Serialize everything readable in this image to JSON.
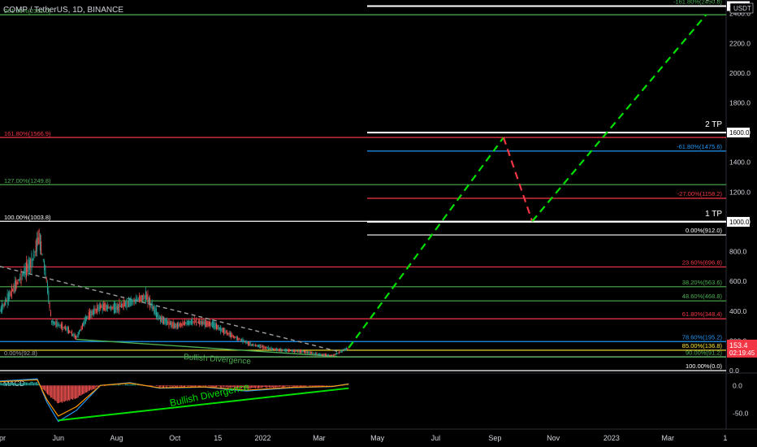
{
  "header": {
    "title": "COMP / TetherUS, 1D, BINANCE",
    "currency": "USDT"
  },
  "price_axis": {
    "ticks": [
      "2400.0",
      "2200.0",
      "2000.0",
      "1800.0",
      "1600.0",
      "1400.0",
      "1200.0",
      "1000.0",
      "800.0",
      "600.0",
      "400.0",
      "200.0",
      "0.0"
    ],
    "last_price": "153.4",
    "countdown": "02:19:45",
    "last_price_color": "#f23645"
  },
  "macd_axis": {
    "label": "MACD",
    "ticks": [
      "0.0",
      "-50.0"
    ]
  },
  "time_axis": {
    "labels": [
      "Apr",
      "Jun",
      "Aug",
      "Oct",
      "15",
      "2022",
      "Mar",
      "May",
      "Jul",
      "Sep",
      "Nov",
      "2023",
      "Mar",
      "1"
    ]
  },
  "targets": [
    "3 TP",
    "2 TP",
    "1 TP"
  ],
  "target_prices": [
    "2450.0",
    "1600.0",
    "1000.0"
  ],
  "annotations": {
    "divergence_price": "Bullish Divergence",
    "divergence_macd": "Bullish Divergence"
  },
  "fib_levels_right": [
    {
      "label": "-161.80%(2450.8)",
      "price": 2450.8,
      "color": "#4caf50"
    },
    {
      "label": "-61.80%(1475.6)",
      "price": 1475.6,
      "color": "#2196f3"
    },
    {
      "label": "-27.00%(1158.2)",
      "price": 1158.2,
      "color": "#f23645"
    },
    {
      "label": "0.00%(912.0)",
      "price": 912.0,
      "color": "#ffffff"
    },
    {
      "label": "23.60%(696.8)",
      "price": 696.8,
      "color": "#f23645"
    },
    {
      "label": "38.20%(563.6)",
      "price": 563.6,
      "color": "#4caf50"
    },
    {
      "label": "48.60%(468.8)",
      "price": 468.8,
      "color": "#4caf50"
    },
    {
      "label": "61.80%(348.4)",
      "price": 348.4,
      "color": "#f23645"
    },
    {
      "label": "78.60%(195.2)",
      "price": 195.2,
      "color": "#2196f3"
    },
    {
      "label": "85.00%(136.8)",
      "price": 136.8,
      "color": "#ffeb3b"
    },
    {
      "label": "90.00%(91.2)",
      "price": 91.2,
      "color": "#4caf50"
    },
    {
      "label": "100.00%(0.0)",
      "price": 0.0,
      "color": "#ffffff"
    }
  ],
  "fib_levels_left": [
    {
      "label": "261.80%(2392.0)",
      "price": 2392.0,
      "color": "#4caf50"
    },
    {
      "label": "161.80%(1566.9)",
      "price": 1566.9,
      "color": "#f23645"
    },
    {
      "label": "127.00%(1249.8)",
      "price": 1249.8,
      "color": "#4caf50"
    },
    {
      "label": "100.00%(1003.8)",
      "price": 1003.8,
      "color": "#ffffff"
    },
    {
      "label": "0.00%(92.8)",
      "price": 92.8,
      "color": "#9e9e9e"
    }
  ],
  "chart_data": {
    "type": "candlestick",
    "symbol": "COMP / TetherUS",
    "interval": "1D",
    "exchange": "BINANCE",
    "ylim": [
      0,
      2480
    ],
    "x_start": "2021-04-01",
    "x_end": "2023-05-01",
    "price_path": [
      {
        "date": "2021-04-01",
        "value": 400
      },
      {
        "date": "2021-04-20",
        "value": 600
      },
      {
        "date": "2021-05-05",
        "value": 740
      },
      {
        "date": "2021-05-12",
        "value": 900
      },
      {
        "date": "2021-05-19",
        "value": 650
      },
      {
        "date": "2021-05-25",
        "value": 330
      },
      {
        "date": "2021-06-10",
        "value": 280
      },
      {
        "date": "2021-06-20",
        "value": 220
      },
      {
        "date": "2021-07-01",
        "value": 360
      },
      {
        "date": "2021-07-15",
        "value": 430
      },
      {
        "date": "2021-08-01",
        "value": 420
      },
      {
        "date": "2021-08-15",
        "value": 460
      },
      {
        "date": "2021-09-01",
        "value": 500
      },
      {
        "date": "2021-09-15",
        "value": 350
      },
      {
        "date": "2021-10-01",
        "value": 300
      },
      {
        "date": "2021-10-20",
        "value": 330
      },
      {
        "date": "2021-11-10",
        "value": 310
      },
      {
        "date": "2021-12-01",
        "value": 230
      },
      {
        "date": "2021-12-20",
        "value": 175
      },
      {
        "date": "2022-01-15",
        "value": 140
      },
      {
        "date": "2022-02-10",
        "value": 130
      },
      {
        "date": "2022-03-01",
        "value": 110
      },
      {
        "date": "2022-03-15",
        "value": 100
      },
      {
        "date": "2022-04-01",
        "value": 153.4
      }
    ],
    "projection": [
      {
        "date": "2022-04-01",
        "value": 153.4
      },
      {
        "date": "2022-09-10",
        "value": 1566.9
      },
      {
        "date": "2022-10-10",
        "value": 1003.8
      },
      {
        "date": "2023-04-10",
        "value": 2392
      }
    ],
    "projection_colors": [
      "#00e000",
      "#f23645",
      "#00e000"
    ],
    "trendlines": [
      {
        "name": "resistance",
        "from": {
          "date": "2021-04-01",
          "value": 700
        },
        "to": {
          "date": "2022-03-20",
          "value": 130
        },
        "color": "#9e9e9e",
        "style": "dashed"
      },
      {
        "name": "support",
        "from": {
          "date": "2021-06-20",
          "value": 210
        },
        "to": {
          "date": "2022-03-20",
          "value": 95
        },
        "color": "#4caf50",
        "style": "solid"
      }
    ],
    "macd": {
      "ylim": [
        -70,
        18
      ],
      "path": [
        {
          "date": "2021-04-01",
          "value": 8
        },
        {
          "date": "2021-05-10",
          "value": 12
        },
        {
          "date": "2021-05-20",
          "value": -30
        },
        {
          "date": "2021-06-01",
          "value": -65
        },
        {
          "date": "2021-06-20",
          "value": -45
        },
        {
          "date": "2021-07-15",
          "value": 0
        },
        {
          "date": "2021-08-15",
          "value": 5
        },
        {
          "date": "2021-09-15",
          "value": -5
        },
        {
          "date": "2021-11-01",
          "value": -3
        },
        {
          "date": "2021-12-15",
          "value": -10
        },
        {
          "date": "2022-02-01",
          "value": -4
        },
        {
          "date": "2022-03-15",
          "value": -2
        },
        {
          "date": "2022-04-01",
          "value": 3
        }
      ],
      "divergence_line": {
        "from": {
          "date": "2021-06-01",
          "value": -63
        },
        "to": {
          "date": "2022-04-01",
          "value": -5
        }
      }
    }
  }
}
